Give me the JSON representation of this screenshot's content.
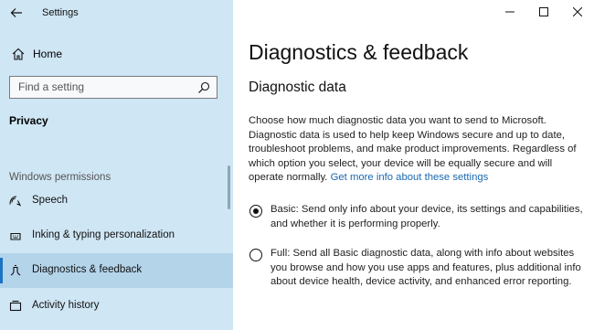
{
  "window": {
    "title": "Settings",
    "controls": [
      "minimize",
      "maximize",
      "close"
    ]
  },
  "sidebar": {
    "home_label": "Home",
    "search_placeholder": "Find a setting",
    "section_title": "Privacy",
    "group_label": "Windows permissions",
    "items": [
      {
        "label": "Speech",
        "icon": "speech-icon"
      },
      {
        "label": "Inking & typing personalization",
        "icon": "inking-icon"
      },
      {
        "label": "Diagnostics & feedback",
        "icon": "diagnostics-icon",
        "selected": true
      },
      {
        "label": "Activity history",
        "icon": "activity-history-icon"
      }
    ]
  },
  "main": {
    "page_title": "Diagnostics & feedback",
    "section_title": "Diagnostic data",
    "description": "Choose how much diagnostic data you want to send to Microsoft. Diagnostic data is used to help keep Windows secure and up to date, troubleshoot problems, and make product improvements. Regardless of which option you select, your device will be equally secure and will operate normally.",
    "description_link": "Get more info about these settings",
    "options": [
      {
        "label": "Basic: Send only info about your device, its settings and capabilities, and whether it is performing properly.",
        "checked": true
      },
      {
        "label": "Full: Send all Basic diagnostic data, along with info about websites you browse and how you use apps and features, plus additional info about device health, device activity, and enhanced error reporting.",
        "checked": false
      }
    ]
  },
  "colors": {
    "sidebar_bg": "#cfe6f4",
    "selected_bg": "#b4d4ea",
    "accent": "#1a74c2",
    "link": "#1a68b0"
  }
}
